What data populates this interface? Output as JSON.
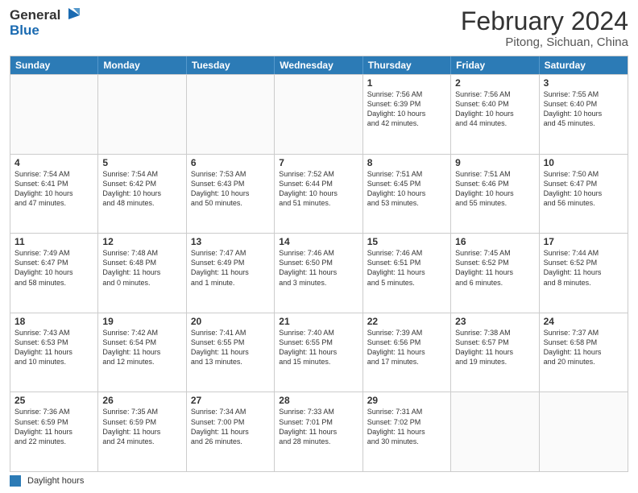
{
  "header": {
    "logo_line1": "General",
    "logo_line2": "Blue",
    "month_title": "February 2024",
    "subtitle": "Pitong, Sichuan, China"
  },
  "days_of_week": [
    "Sunday",
    "Monday",
    "Tuesday",
    "Wednesday",
    "Thursday",
    "Friday",
    "Saturday"
  ],
  "legend_label": "Daylight hours",
  "weeks": [
    [
      {
        "day": "",
        "info": ""
      },
      {
        "day": "",
        "info": ""
      },
      {
        "day": "",
        "info": ""
      },
      {
        "day": "",
        "info": ""
      },
      {
        "day": "1",
        "info": "Sunrise: 7:56 AM\nSunset: 6:39 PM\nDaylight: 10 hours\nand 42 minutes."
      },
      {
        "day": "2",
        "info": "Sunrise: 7:56 AM\nSunset: 6:40 PM\nDaylight: 10 hours\nand 44 minutes."
      },
      {
        "day": "3",
        "info": "Sunrise: 7:55 AM\nSunset: 6:40 PM\nDaylight: 10 hours\nand 45 minutes."
      }
    ],
    [
      {
        "day": "4",
        "info": "Sunrise: 7:54 AM\nSunset: 6:41 PM\nDaylight: 10 hours\nand 47 minutes."
      },
      {
        "day": "5",
        "info": "Sunrise: 7:54 AM\nSunset: 6:42 PM\nDaylight: 10 hours\nand 48 minutes."
      },
      {
        "day": "6",
        "info": "Sunrise: 7:53 AM\nSunset: 6:43 PM\nDaylight: 10 hours\nand 50 minutes."
      },
      {
        "day": "7",
        "info": "Sunrise: 7:52 AM\nSunset: 6:44 PM\nDaylight: 10 hours\nand 51 minutes."
      },
      {
        "day": "8",
        "info": "Sunrise: 7:51 AM\nSunset: 6:45 PM\nDaylight: 10 hours\nand 53 minutes."
      },
      {
        "day": "9",
        "info": "Sunrise: 7:51 AM\nSunset: 6:46 PM\nDaylight: 10 hours\nand 55 minutes."
      },
      {
        "day": "10",
        "info": "Sunrise: 7:50 AM\nSunset: 6:47 PM\nDaylight: 10 hours\nand 56 minutes."
      }
    ],
    [
      {
        "day": "11",
        "info": "Sunrise: 7:49 AM\nSunset: 6:47 PM\nDaylight: 10 hours\nand 58 minutes."
      },
      {
        "day": "12",
        "info": "Sunrise: 7:48 AM\nSunset: 6:48 PM\nDaylight: 11 hours\nand 0 minutes."
      },
      {
        "day": "13",
        "info": "Sunrise: 7:47 AM\nSunset: 6:49 PM\nDaylight: 11 hours\nand 1 minute."
      },
      {
        "day": "14",
        "info": "Sunrise: 7:46 AM\nSunset: 6:50 PM\nDaylight: 11 hours\nand 3 minutes."
      },
      {
        "day": "15",
        "info": "Sunrise: 7:46 AM\nSunset: 6:51 PM\nDaylight: 11 hours\nand 5 minutes."
      },
      {
        "day": "16",
        "info": "Sunrise: 7:45 AM\nSunset: 6:52 PM\nDaylight: 11 hours\nand 6 minutes."
      },
      {
        "day": "17",
        "info": "Sunrise: 7:44 AM\nSunset: 6:52 PM\nDaylight: 11 hours\nand 8 minutes."
      }
    ],
    [
      {
        "day": "18",
        "info": "Sunrise: 7:43 AM\nSunset: 6:53 PM\nDaylight: 11 hours\nand 10 minutes."
      },
      {
        "day": "19",
        "info": "Sunrise: 7:42 AM\nSunset: 6:54 PM\nDaylight: 11 hours\nand 12 minutes."
      },
      {
        "day": "20",
        "info": "Sunrise: 7:41 AM\nSunset: 6:55 PM\nDaylight: 11 hours\nand 13 minutes."
      },
      {
        "day": "21",
        "info": "Sunrise: 7:40 AM\nSunset: 6:55 PM\nDaylight: 11 hours\nand 15 minutes."
      },
      {
        "day": "22",
        "info": "Sunrise: 7:39 AM\nSunset: 6:56 PM\nDaylight: 11 hours\nand 17 minutes."
      },
      {
        "day": "23",
        "info": "Sunrise: 7:38 AM\nSunset: 6:57 PM\nDaylight: 11 hours\nand 19 minutes."
      },
      {
        "day": "24",
        "info": "Sunrise: 7:37 AM\nSunset: 6:58 PM\nDaylight: 11 hours\nand 20 minutes."
      }
    ],
    [
      {
        "day": "25",
        "info": "Sunrise: 7:36 AM\nSunset: 6:59 PM\nDaylight: 11 hours\nand 22 minutes."
      },
      {
        "day": "26",
        "info": "Sunrise: 7:35 AM\nSunset: 6:59 PM\nDaylight: 11 hours\nand 24 minutes."
      },
      {
        "day": "27",
        "info": "Sunrise: 7:34 AM\nSunset: 7:00 PM\nDaylight: 11 hours\nand 26 minutes."
      },
      {
        "day": "28",
        "info": "Sunrise: 7:33 AM\nSunset: 7:01 PM\nDaylight: 11 hours\nand 28 minutes."
      },
      {
        "day": "29",
        "info": "Sunrise: 7:31 AM\nSunset: 7:02 PM\nDaylight: 11 hours\nand 30 minutes."
      },
      {
        "day": "",
        "info": ""
      },
      {
        "day": "",
        "info": ""
      }
    ]
  ]
}
